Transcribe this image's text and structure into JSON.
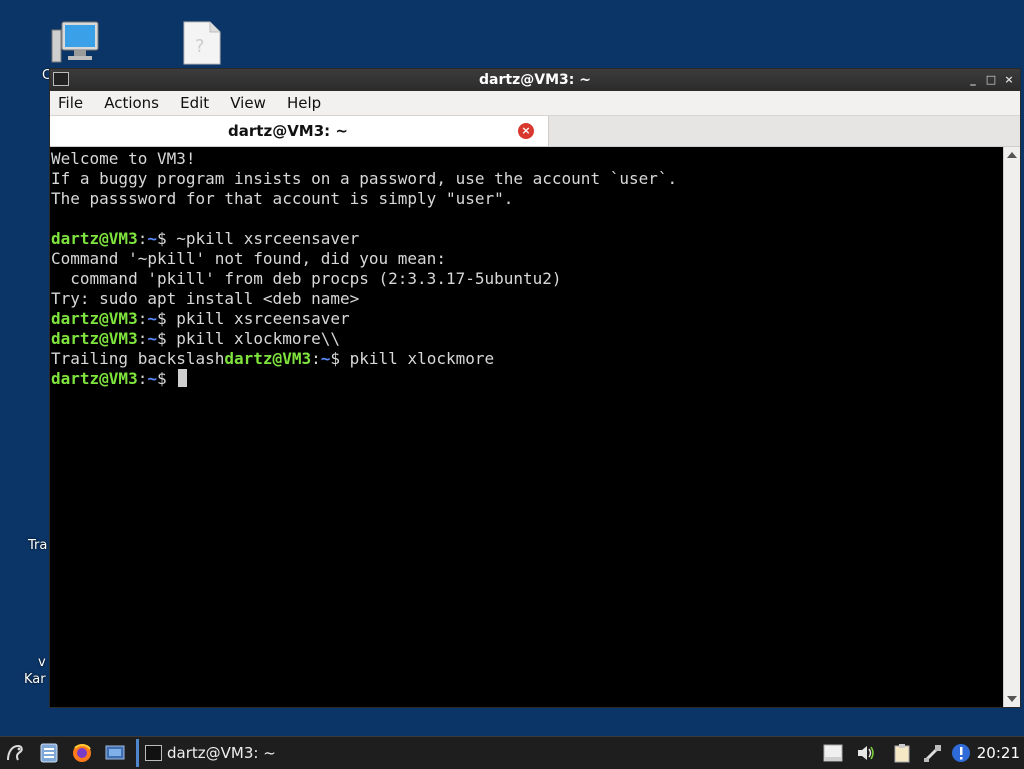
{
  "desktop": {
    "icons": [
      {
        "name": "computer",
        "label": "C"
      },
      {
        "name": "document",
        "label": ""
      },
      {
        "name": "trash",
        "label": "Tra"
      },
      {
        "name": "bottom",
        "label": "v\nKar"
      }
    ]
  },
  "window": {
    "title": "dartz@VM3: ~",
    "menu": [
      "File",
      "Actions",
      "Edit",
      "View",
      "Help"
    ],
    "tab_title": "dartz@VM3: ~",
    "close_glyph": "×"
  },
  "terminal": {
    "prompt_user": "dartz@VM3",
    "prompt_path": "~",
    "lines": [
      {
        "type": "text",
        "text": "Welcome to VM3!"
      },
      {
        "type": "text",
        "text": "If a buggy program insists on a password, use the account `user`."
      },
      {
        "type": "text",
        "text": "The passsword for that account is simply \"user\"."
      },
      {
        "type": "text",
        "text": ""
      },
      {
        "type": "prompt",
        "cmd": " ~pkill xsrceensaver"
      },
      {
        "type": "text",
        "text": "Command '~pkill' not found, did you mean:"
      },
      {
        "type": "text",
        "text": "  command 'pkill' from deb procps (2:3.3.17-5ubuntu2)"
      },
      {
        "type": "text",
        "text": "Try: sudo apt install <deb name>"
      },
      {
        "type": "prompt",
        "cmd": " pkill xsrceensaver"
      },
      {
        "type": "prompt",
        "cmd": " pkill xlockmore\\\\"
      },
      {
        "type": "mixed",
        "pre": "Trailing backslash",
        "cmd": " pkill xlockmore"
      },
      {
        "type": "prompt-cursor",
        "cmd": " "
      }
    ]
  },
  "taskbar": {
    "task_label": "dartz@VM3: ~",
    "clock": "20:21"
  }
}
